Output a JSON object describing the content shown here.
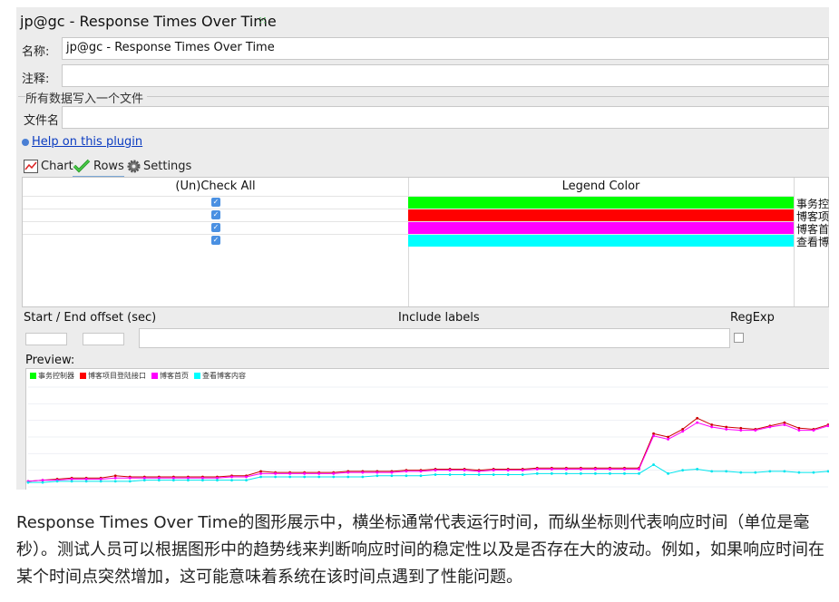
{
  "window": {
    "title": "jp@gc - Response Times Over Time"
  },
  "form": {
    "name_label": "名称:",
    "name_value": "jp@gc - Response Times Over Time",
    "comment_label": "注释:",
    "comment_value": "",
    "group_title": "所有数据写入一个文件",
    "file_label": "文件名",
    "file_value": ""
  },
  "help_link": "Help on this plugin",
  "tabs": [
    {
      "label": "Chart",
      "icon": "chart-icon"
    },
    {
      "label": "Rows",
      "icon": "checkmark-icon",
      "active": true
    },
    {
      "label": "Settings",
      "icon": "gear-icon"
    }
  ],
  "rows_table": {
    "headers": [
      "(Un)Check All",
      "Legend Color"
    ],
    "rows": [
      {
        "checked": true,
        "color": "#00ff00",
        "label": "事务控"
      },
      {
        "checked": true,
        "color": "#ff0000",
        "label": "博客项"
      },
      {
        "checked": true,
        "color": "#ff00ff",
        "label": "博客首"
      },
      {
        "checked": true,
        "color": "#00ffff",
        "label": "查看博"
      }
    ]
  },
  "filters": {
    "offset_label": "Start / End offset (sec)",
    "include_label": "Include labels",
    "regexp_label": "RegExp"
  },
  "preview_label": "Preview:",
  "chart_data": {
    "type": "line",
    "title": "",
    "xlabel": "",
    "ylabel": "",
    "series": [
      {
        "name": "事务控制器",
        "color": "#00ff00",
        "values": []
      },
      {
        "name": "博客项目登陆接口",
        "color": "#cc0000",
        "values": [
          5,
          6,
          7,
          8,
          8,
          8,
          10,
          9,
          9,
          9,
          9,
          9,
          9,
          9,
          10,
          10,
          14,
          13,
          13,
          13,
          13,
          13,
          14,
          14,
          14,
          14,
          15,
          15,
          16,
          16,
          16,
          15,
          16,
          16,
          16,
          17,
          17,
          17,
          17,
          17,
          17,
          17,
          17,
          48,
          45,
          52,
          62,
          56,
          54,
          53,
          52,
          55,
          58,
          53,
          52,
          56
        ]
      },
      {
        "name": "博客首页",
        "color": "#ff00ff",
        "values": [
          5,
          6,
          6,
          7,
          7,
          7,
          8,
          8,
          8,
          8,
          8,
          8,
          8,
          8,
          9,
          9,
          12,
          12,
          12,
          12,
          12,
          12,
          13,
          13,
          13,
          13,
          14,
          14,
          15,
          15,
          15,
          14,
          15,
          15,
          15,
          16,
          16,
          16,
          16,
          16,
          16,
          16,
          16,
          46,
          43,
          50,
          58,
          54,
          52,
          51,
          51,
          54,
          56,
          51,
          51,
          55
        ]
      },
      {
        "name": "查看博客内容",
        "color": "#00e5ee",
        "values": [
          4,
          4,
          5,
          5,
          5,
          5,
          5,
          5,
          6,
          6,
          6,
          6,
          6,
          6,
          6,
          6,
          9,
          9,
          9,
          9,
          9,
          9,
          9,
          9,
          10,
          10,
          10,
          10,
          11,
          11,
          11,
          11,
          11,
          11,
          11,
          12,
          12,
          12,
          12,
          12,
          12,
          12,
          12,
          20,
          12,
          15,
          16,
          14,
          14,
          13,
          13,
          14,
          14,
          13,
          13,
          14
        ]
      }
    ]
  },
  "caption": "Response Times Over Time的图形展示中，横坐标通常代表运行时间，而纵坐标则代表响应时间（单位是毫秒）。测试人员可以根据图形中的趋势线来判断响应时间的稳定性以及是否存在大的波动。例如，如果响应时间在某个时间点突然增加，这可能意味着系统在该时间点遇到了性能问题。"
}
